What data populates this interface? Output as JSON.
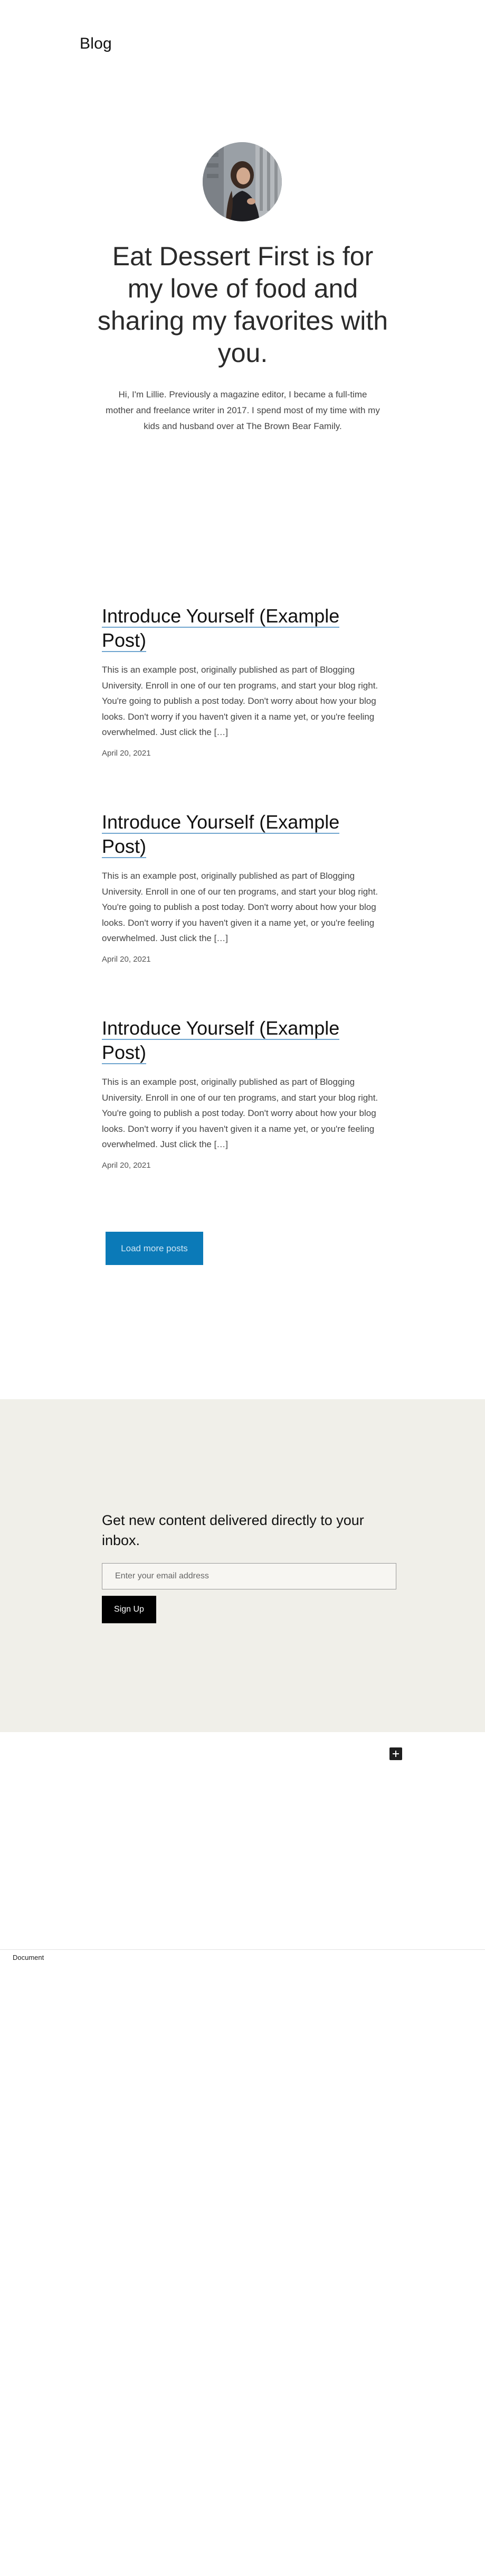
{
  "site": {
    "title": "Blog"
  },
  "hero": {
    "title": "Eat Dessert First is for my love of food and sharing my favorites with you.",
    "bio": "Hi, I'm Lillie. Previously a magazine editor, I became a full-time mother and freelance writer in 2017. I spend most of my time with my kids and husband over at The Brown Bear Family."
  },
  "posts": [
    {
      "title": "Introduce Yourself (Example Post)",
      "excerpt": "This is an example post, originally published as part of Blogging University. Enroll in one of our ten programs, and start your blog right. You're going to publish a post today. Don't worry about how your blog looks. Don't worry if you haven't given it a name yet, or you're feeling overwhelmed. Just click the […]",
      "date": "April 20, 2021"
    },
    {
      "title": "Introduce Yourself (Example Post)",
      "excerpt": "This is an example post, originally published as part of Blogging University. Enroll in one of our ten programs, and start your blog right. You're going to publish a post today. Don't worry about how your blog looks. Don't worry if you haven't given it a name yet, or you're feeling overwhelmed. Just click the […]",
      "date": "April 20, 2021"
    },
    {
      "title": "Introduce Yourself (Example Post)",
      "excerpt": "This is an example post, originally published as part of Blogging University. Enroll in one of our ten programs, and start your blog right. You're going to publish a post today. Don't worry about how your blog looks. Don't worry if you haven't given it a name yet, or you're feeling overwhelmed. Just click the […]",
      "date": "April 20, 2021"
    }
  ],
  "load_more": {
    "label": "Load more posts"
  },
  "newsletter": {
    "heading": "Get new content delivered directly to your inbox.",
    "email_placeholder": "Enter your email address",
    "email_value": "",
    "signup_label": "Sign Up"
  },
  "editor": {
    "add_block_icon": "plus-icon",
    "breadcrumb": "Document"
  },
  "colors": {
    "accent_button": "#0b7ab8",
    "newsletter_bg": "#f0efe9",
    "link_underline": "#6fa5cf"
  }
}
